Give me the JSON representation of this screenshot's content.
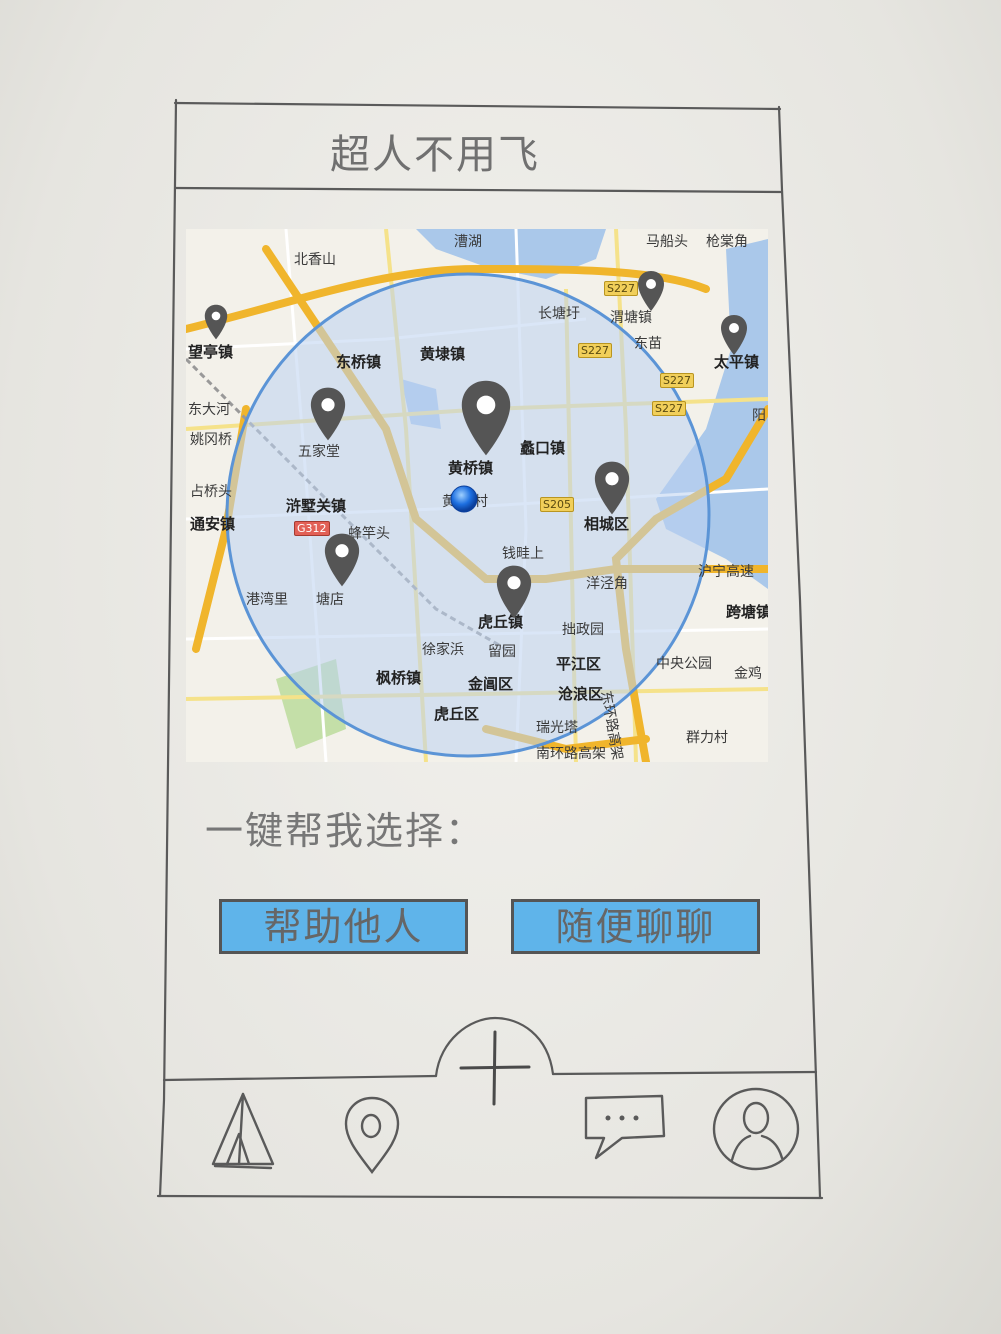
{
  "app": {
    "title": "超人不用飞"
  },
  "map": {
    "labels": [
      {
        "text": "漕湖",
        "kind": "normal"
      },
      {
        "text": "马船头",
        "kind": "normal"
      },
      {
        "text": "枪棠角",
        "kind": "normal"
      },
      {
        "text": "北香山",
        "kind": "normal"
      },
      {
        "text": "长塘圩",
        "kind": "normal"
      },
      {
        "text": "渭塘镇",
        "kind": "normal"
      },
      {
        "text": "东桥镇",
        "kind": "big"
      },
      {
        "text": "黄埭镇",
        "kind": "big"
      },
      {
        "text": "东苗",
        "kind": "normal"
      },
      {
        "text": "太平镇",
        "kind": "big"
      },
      {
        "text": "望亭镇",
        "kind": "big"
      },
      {
        "text": "东大河",
        "kind": "normal"
      },
      {
        "text": "姚冈桥",
        "kind": "normal"
      },
      {
        "text": "五家堂",
        "kind": "normal"
      },
      {
        "text": "蠡口镇",
        "kind": "big"
      },
      {
        "text": "黄桥镇",
        "kind": "big"
      },
      {
        "text": "阳",
        "kind": "normal"
      },
      {
        "text": "占桥头",
        "kind": "normal"
      },
      {
        "text": "浒墅关镇",
        "kind": "big"
      },
      {
        "text": "通安镇",
        "kind": "big"
      },
      {
        "text": "相城区",
        "kind": "big"
      },
      {
        "text": "蜂竿头",
        "kind": "normal"
      },
      {
        "text": "钱畦上",
        "kind": "normal"
      },
      {
        "text": "沪宁高速",
        "kind": "normal"
      },
      {
        "text": "洋泾角",
        "kind": "normal"
      },
      {
        "text": "港湾里",
        "kind": "normal"
      },
      {
        "text": "塘店",
        "kind": "normal"
      },
      {
        "text": "虎丘镇",
        "kind": "big"
      },
      {
        "text": "跨塘镇",
        "kind": "big"
      },
      {
        "text": "拙政园",
        "kind": "normal"
      },
      {
        "text": "徐家浜",
        "kind": "normal"
      },
      {
        "text": "留园",
        "kind": "normal"
      },
      {
        "text": "平江区",
        "kind": "big"
      },
      {
        "text": "中央公园",
        "kind": "normal"
      },
      {
        "text": "金鸡",
        "kind": "normal"
      },
      {
        "text": "枫桥镇",
        "kind": "big"
      },
      {
        "text": "金阊区",
        "kind": "big"
      },
      {
        "text": "沧浪区",
        "kind": "big"
      },
      {
        "text": "东环路高架",
        "kind": "normal"
      },
      {
        "text": "虎丘区",
        "kind": "big"
      },
      {
        "text": "瑞光塔",
        "kind": "normal"
      },
      {
        "text": "群力村",
        "kind": "normal"
      },
      {
        "text": "南环路高架",
        "kind": "normal"
      },
      {
        "text": "黄",
        "kind": "normal"
      },
      {
        "text": "村",
        "kind": "normal"
      }
    ],
    "roads": [
      "S227",
      "S227",
      "S227",
      "S227",
      "S205",
      "G312"
    ],
    "search_radius": "circle"
  },
  "prompt": {
    "label": "一键帮我选择："
  },
  "actions": {
    "help_others": "帮助他人",
    "casual_chat": "随便聊聊"
  },
  "tabbar": {
    "add": "plus-icon",
    "tabs": [
      {
        "name": "home-tent-icon"
      },
      {
        "name": "location-pin-icon"
      },
      {
        "name": "chat-bubble-icon"
      },
      {
        "name": "profile-icon"
      }
    ]
  },
  "colors": {
    "button_fill": "#5fb4ea",
    "circle_fill": "#c8d9f0",
    "circle_stroke": "#5b94d6",
    "pin": "#555555",
    "road_major": "#f0b52c"
  }
}
